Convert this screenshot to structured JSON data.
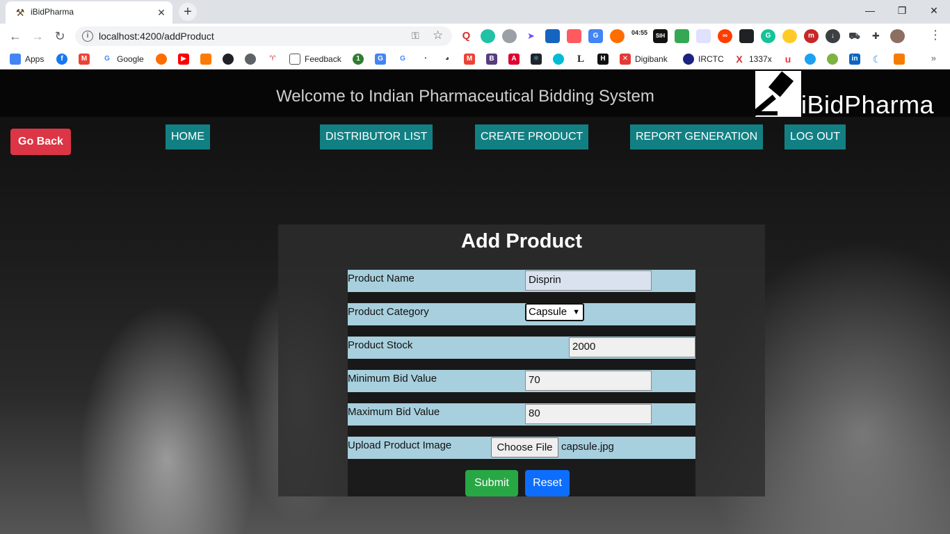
{
  "browser": {
    "tab_title": "iBidPharma",
    "url": "localhost:4200/addProduct",
    "bookmarks": [
      "Apps",
      "Google",
      "Feedback",
      "Digibank",
      "IRCTC",
      "1337x"
    ],
    "extension_clock": "04:55"
  },
  "header": {
    "title": "Welcome to Indian Pharmaceutical Bidding System",
    "logo_text": "iBidPharma"
  },
  "nav": {
    "go_back": "Go Back",
    "items": [
      "HOME",
      "DISTRIBUTOR LIST",
      "CREATE PRODUCT",
      "REPORT GENERATION",
      "LOG OUT"
    ]
  },
  "form": {
    "title": "Add Product",
    "product_name": {
      "label": "Product Name",
      "value": "Disprin"
    },
    "product_category": {
      "label": "Product Category",
      "value": "Capsule"
    },
    "product_stock": {
      "label": "Product Stock",
      "value": "2000"
    },
    "min_bid": {
      "label": "Minimum Bid Value",
      "value": "70"
    },
    "max_bid": {
      "label": "Maximum Bid Value",
      "value": "80"
    },
    "image": {
      "label": "Upload Product Image",
      "button": "Choose File",
      "file": "capsule.jpg"
    },
    "submit": "Submit",
    "reset": "Reset"
  },
  "colors": {
    "nav": "#128083",
    "go_back": "#dc3545",
    "submit": "#28a745",
    "reset": "#0d6efd",
    "row": "#a8cfdd"
  }
}
